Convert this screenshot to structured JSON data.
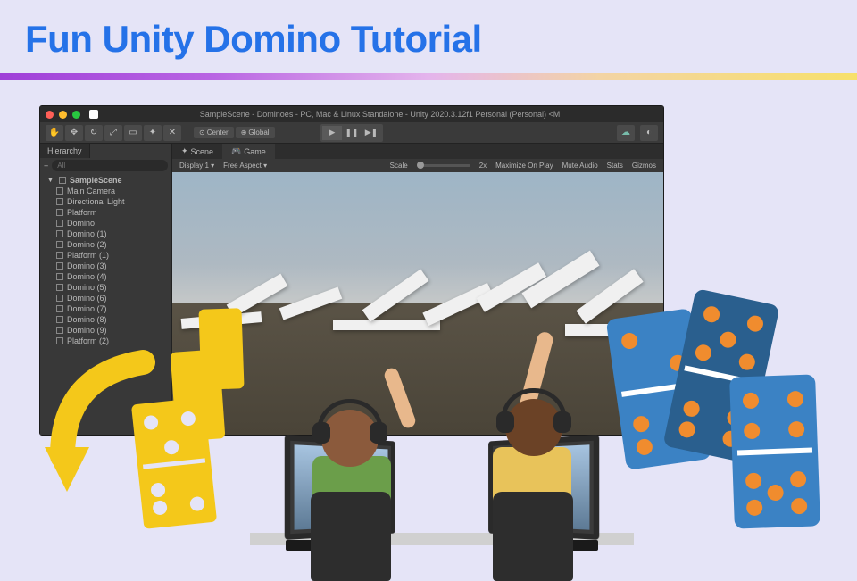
{
  "title": "Fun Unity Domino Tutorial",
  "window": {
    "title": "SampleScene - Dominoes - PC, Mac & Linux Standalone - Unity 2020.3.12f1 Personal (Personal) <M"
  },
  "toolbar": {
    "pivot": "Center",
    "handle": "Global"
  },
  "hierarchy": {
    "tab": "Hierarchy",
    "search_placeholder": "All",
    "root": "SampleScene",
    "items": [
      "Main Camera",
      "Directional Light",
      "Platform",
      "Domino",
      "Domino (1)",
      "Domino (2)",
      "Platform (1)",
      "Domino (3)",
      "Domino (4)",
      "Domino (5)",
      "Domino (6)",
      "Domino (7)",
      "Domino (8)",
      "Domino (9)",
      "Platform (2)"
    ]
  },
  "scene": {
    "tabs": {
      "scene": "Scene",
      "game": "Game"
    },
    "display": "Display 1",
    "aspect": "Free Aspect",
    "scale_label": "Scale",
    "scale_value": "2x",
    "maximize": "Maximize On Play",
    "mute": "Mute Audio",
    "stats": "Stats",
    "gizmos": "Gizmos"
  }
}
